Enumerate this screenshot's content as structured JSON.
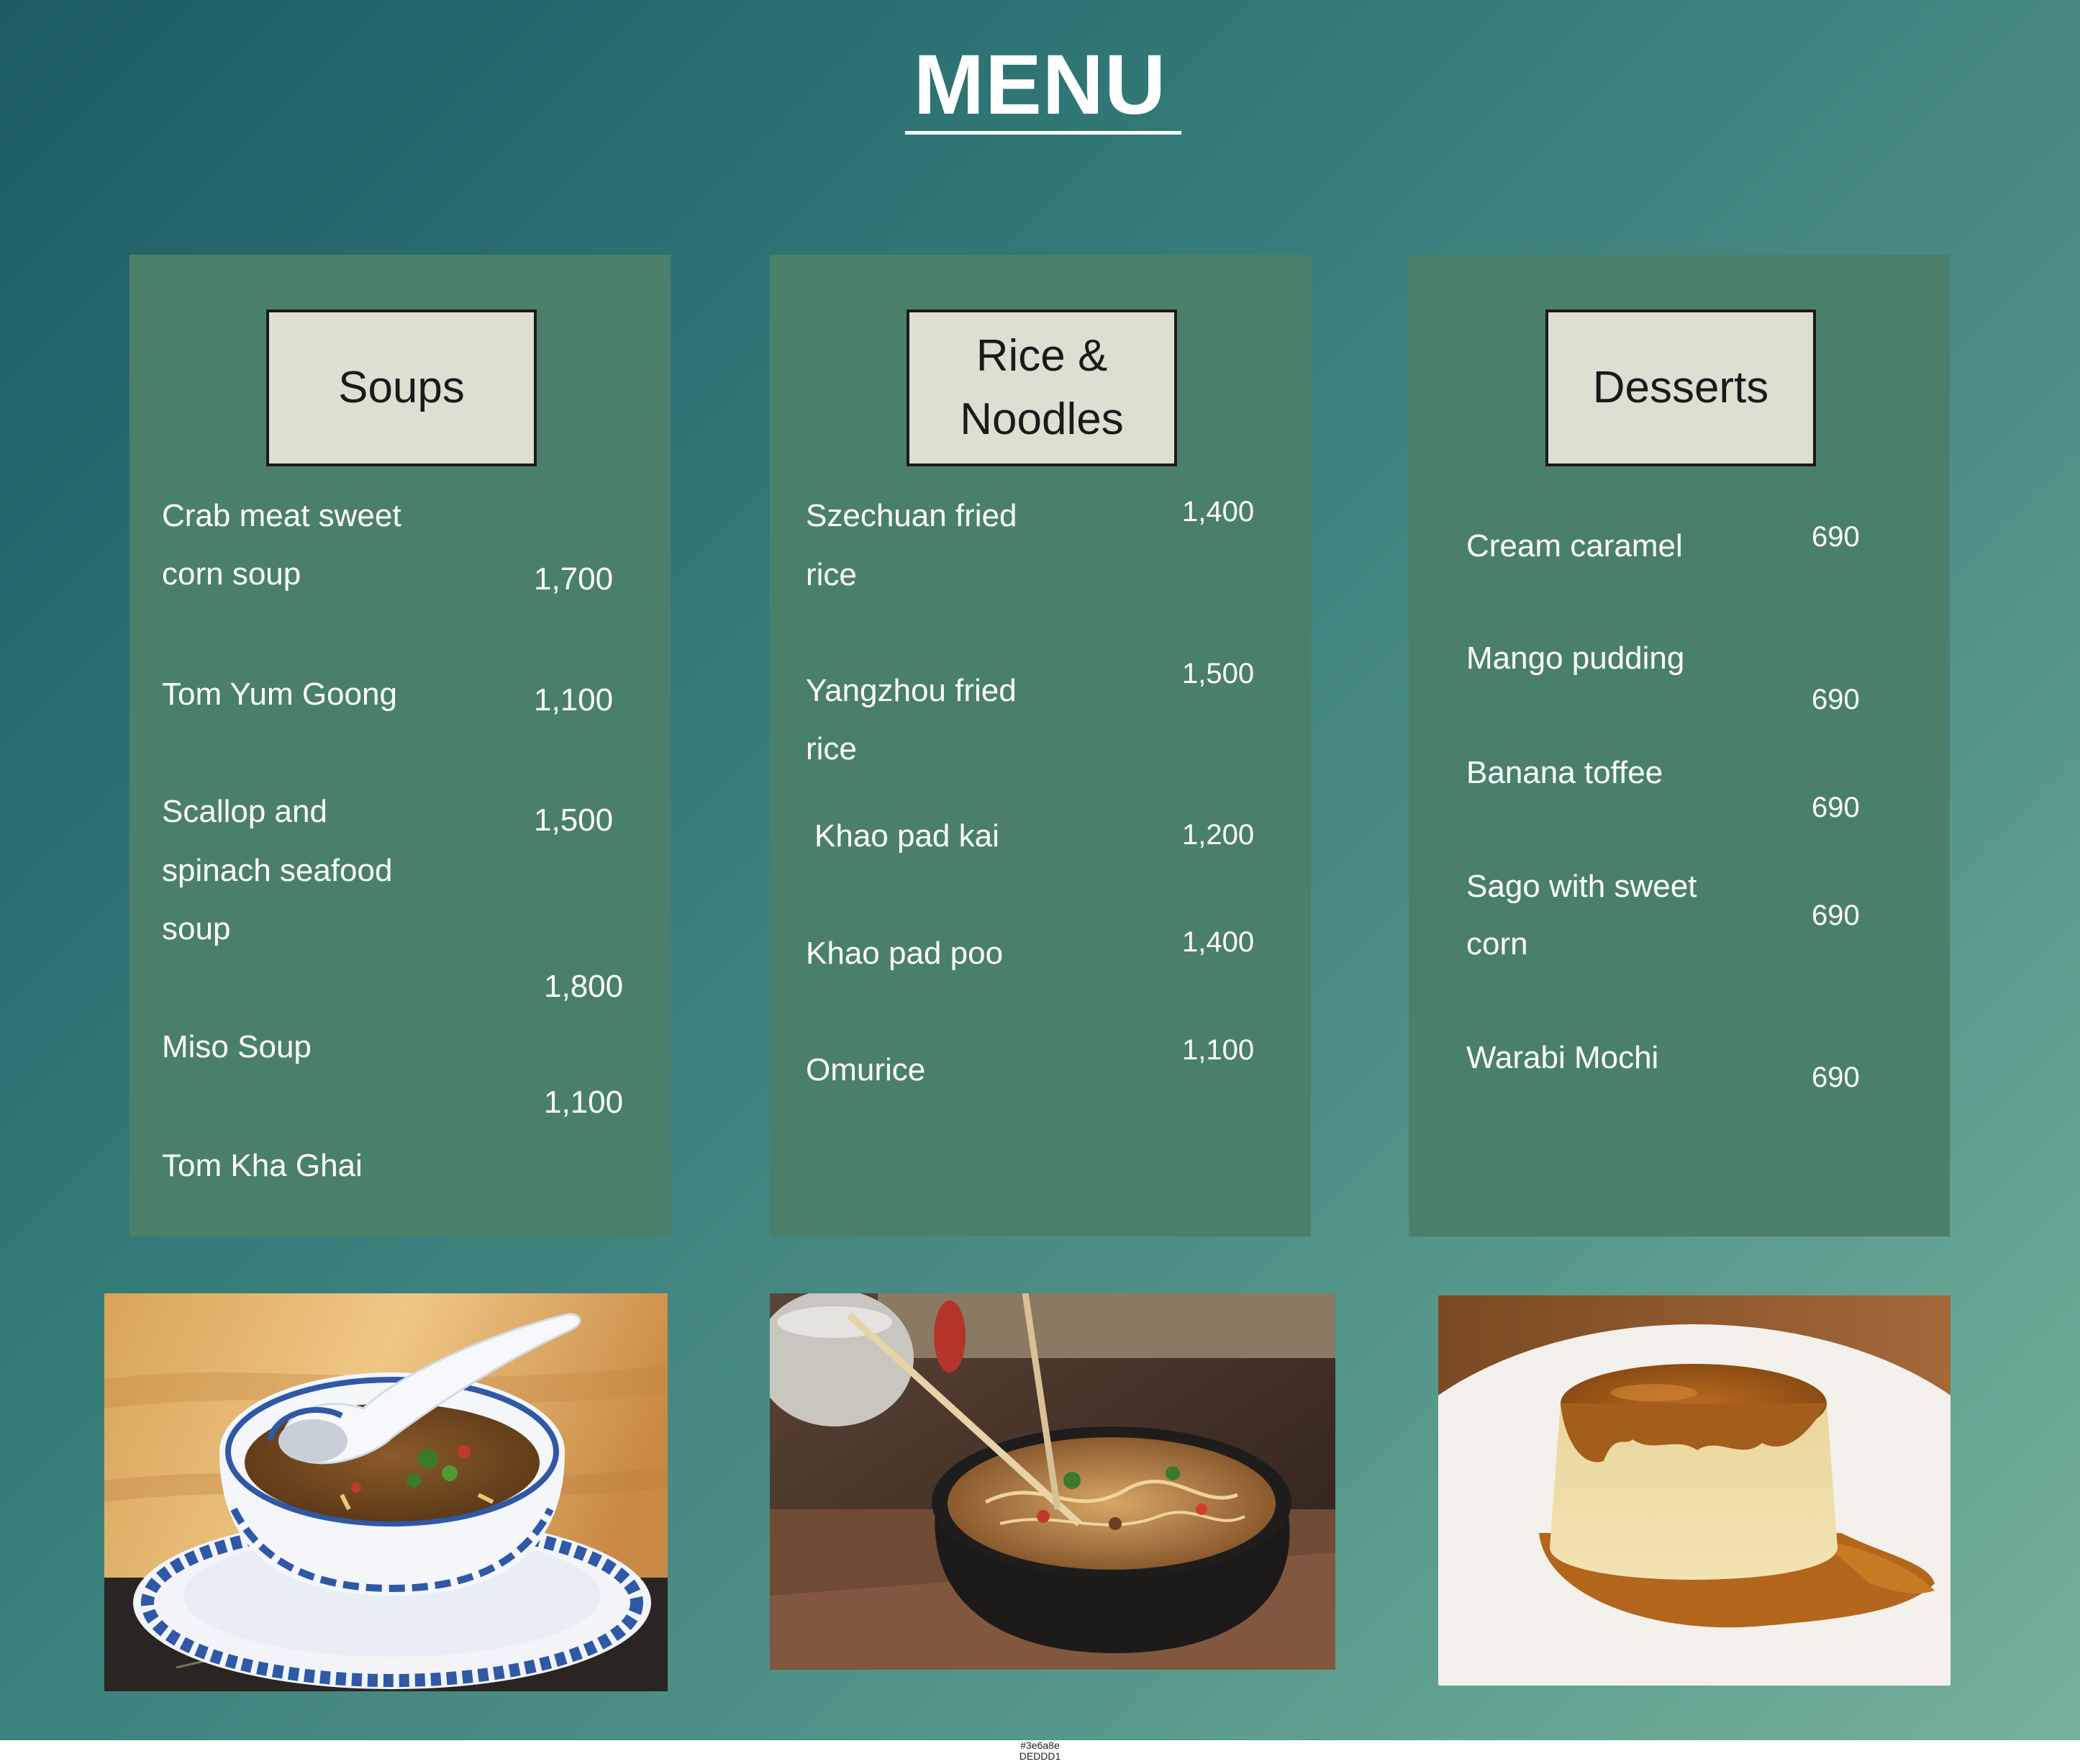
{
  "menu": {
    "title": "MENU",
    "sections": {
      "soups": {
        "heading": "Soups",
        "items": [
          {
            "name_line1": "Crab meat sweet",
            "name_line2": "corn soup",
            "price": "1,700"
          },
          {
            "name_line1": "Tom Yum Goong",
            "price": "1,100"
          },
          {
            "name_line1": "Scallop and",
            "name_line2": "spinach seafood",
            "name_line3": "soup",
            "price": "1,500"
          },
          {
            "name_line1": "Miso Soup",
            "price": "1,800"
          },
          {
            "name_line1": "Tom Kha Ghai",
            "price": "1,100"
          }
        ]
      },
      "rice": {
        "heading_line1": "Rice &",
        "heading_line2": "Noodles",
        "items": [
          {
            "name_line1": "Szechuan fried",
            "name_line2": "rice",
            "price": "1,400"
          },
          {
            "name_line1": "Yangzhou fried",
            "name_line2": "rice",
            "price": "1,500"
          },
          {
            "name_line1": "Khao pad kai",
            "price": "1,200"
          },
          {
            "name_line1": "Khao pad poo",
            "price": "1,400"
          },
          {
            "name_line1": "Omurice",
            "price": "1,100"
          }
        ]
      },
      "desserts": {
        "heading": "Desserts",
        "items": [
          {
            "name_line1": "Cream caramel",
            "price": "690"
          },
          {
            "name_line1": "Mango pudding",
            "price": "690"
          },
          {
            "name_line1": "Banana toffee",
            "price": "690"
          },
          {
            "name_line1": "Sago with sweet",
            "name_line2": "corn",
            "price": "690"
          },
          {
            "name_line1": "Warabi Mochi",
            "price": "690"
          }
        ]
      }
    },
    "footer": {
      "line1": "#3e6a8e",
      "line2": "DEDDD1"
    }
  },
  "colors": {
    "gradient_start": "#1b5c66",
    "gradient_end": "#76b19b",
    "panel": "#4a8069",
    "header_box": "#dedfd1",
    "text": "#ffffff"
  },
  "icons": [
    "soup-photo",
    "noodles-photo",
    "flan-photo"
  ]
}
